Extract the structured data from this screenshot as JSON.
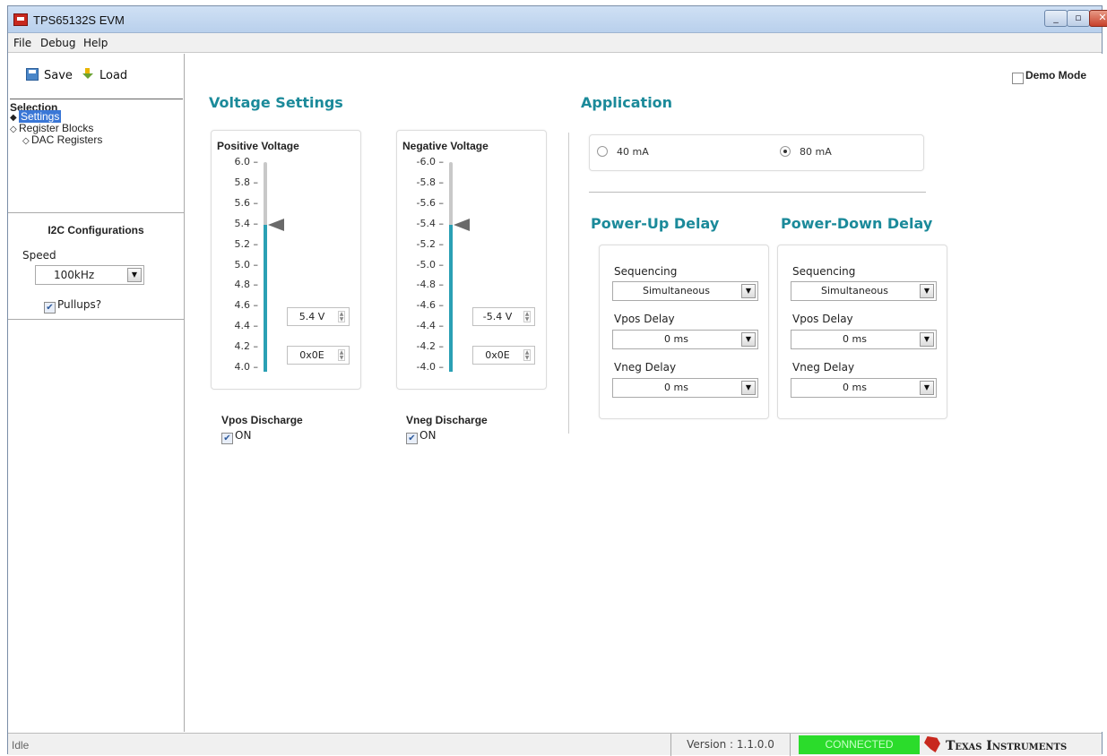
{
  "window": {
    "title": "TPS65132S EVM"
  },
  "menu": [
    "File",
    "Debug",
    "Help"
  ],
  "toolbar": {
    "save": "Save",
    "load": "Load"
  },
  "sidebar": {
    "selection_header": "Selection",
    "tree": [
      {
        "label": "Settings",
        "selected": true
      },
      {
        "label": "Register Blocks"
      },
      {
        "label": "DAC Registers"
      }
    ],
    "i2c": {
      "title": "I2C Configurations",
      "speed_label": "Speed",
      "speed_value": "100kHz",
      "pullups_label": "Pullups?",
      "pullups_checked": true
    }
  },
  "demo_mode": {
    "label": "Demo Mode",
    "checked": false
  },
  "voltage_settings": {
    "title": "Voltage Settings",
    "positive": {
      "title": "Positive Voltage",
      "ticks": [
        "6.0",
        "5.8",
        "5.6",
        "5.4",
        "5.2",
        "5.0",
        "4.8",
        "4.6",
        "4.4",
        "4.2",
        "4.0"
      ],
      "value": "5.4 V",
      "hex": "0x0E",
      "level_fraction": 0.7
    },
    "negative": {
      "title": "Negative Voltage",
      "ticks": [
        "-6.0",
        "-5.8",
        "-5.6",
        "-5.4",
        "-5.2",
        "-5.0",
        "-4.8",
        "-4.6",
        "-4.4",
        "-4.2",
        "-4.0"
      ],
      "value": "-5.4 V",
      "hex": "0x0E",
      "level_fraction": 0.7
    },
    "vpos_discharge": {
      "title": "Vpos Discharge",
      "label": "ON",
      "checked": true
    },
    "vneg_discharge": {
      "title": "Vneg Discharge",
      "label": "ON",
      "checked": true
    }
  },
  "application": {
    "title": "Application",
    "options": [
      "40 mA",
      "80 mA"
    ],
    "selected": "80 mA"
  },
  "power_up": {
    "title": "Power-Up Delay",
    "sequencing_label": "Sequencing",
    "sequencing": "Simultaneous",
    "vpos_label": "Vpos Delay",
    "vpos": "0 ms",
    "vneg_label": "Vneg Delay",
    "vneg": "0 ms"
  },
  "power_down": {
    "title": "Power-Down Delay",
    "sequencing_label": "Sequencing",
    "sequencing": "Simultaneous",
    "vpos_label": "Vpos Delay",
    "vpos": "0 ms",
    "vneg_label": "Vneg Delay",
    "vneg": "0 ms"
  },
  "status": {
    "text": "Idle",
    "version": "Version : 1.1.0.0",
    "connection": "CONNECTED",
    "brand": "Texas Instruments"
  },
  "colors": {
    "accent": "#1b8a9a",
    "slider_fill": "#2aa0b4",
    "connected": "#2bdc2b",
    "selection": "#3a77d6"
  }
}
